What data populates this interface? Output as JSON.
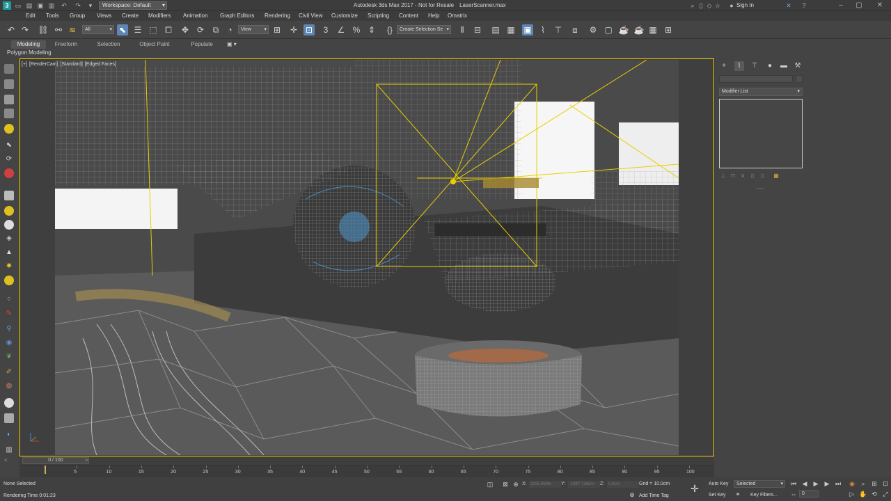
{
  "titlebar": {
    "app_icon": "3ds-max-logo",
    "workspace_label": "Workspace: Default",
    "title": "Autodesk 3ds Max 2017 - Not for Resale",
    "filename": "LaserScanner.max",
    "signin": "Sign In"
  },
  "menubar": {
    "items": [
      "Edit",
      "Tools",
      "Group",
      "Views",
      "Create",
      "Modifiers",
      "Animation",
      "Graph Editors",
      "Rendering",
      "Civil View",
      "Customize",
      "Scripting",
      "Content",
      "Help",
      "Omatrix"
    ]
  },
  "toolbar": {
    "selection_filter": "All",
    "ref_coord": "View",
    "named_selection": "Create Selection Se"
  },
  "ribbon": {
    "tabs": [
      "Modeling",
      "Freeform",
      "Selection",
      "Object Paint",
      "Populate"
    ],
    "active_tab": "Modeling",
    "panel_label": "Polygon Modeling"
  },
  "viewport": {
    "label_parts": [
      "[+]",
      "[RenderCam]",
      "[Standard]",
      "[Edged Faces]"
    ],
    "border_color": "#ffd200"
  },
  "cmdpanel": {
    "modifier_list": "Modifier List"
  },
  "timeline": {
    "slider_label": "0 / 100",
    "ticks": [
      "5",
      "10",
      "15",
      "20",
      "25",
      "30",
      "35",
      "40",
      "45",
      "50",
      "55",
      "60",
      "65",
      "70",
      "75",
      "80",
      "85",
      "90",
      "95",
      "100"
    ],
    "current_frame": 0
  },
  "status": {
    "selection": "None Selected",
    "render_time": "Rendering Time  0:01:23",
    "x_label": "X:",
    "x_value": "2025.969m",
    "y_label": "Y:",
    "y_value": "-1897.726cm",
    "z_label": "Z:",
    "z_value": "0.0cm",
    "grid": "Grid = 10.0cm",
    "add_time_tag": "Add Time Tag",
    "auto_key": "Auto Key",
    "set_key": "Set Key",
    "key_mode": "Selected",
    "key_filters": "Key Filters...",
    "frame_value": "0"
  }
}
